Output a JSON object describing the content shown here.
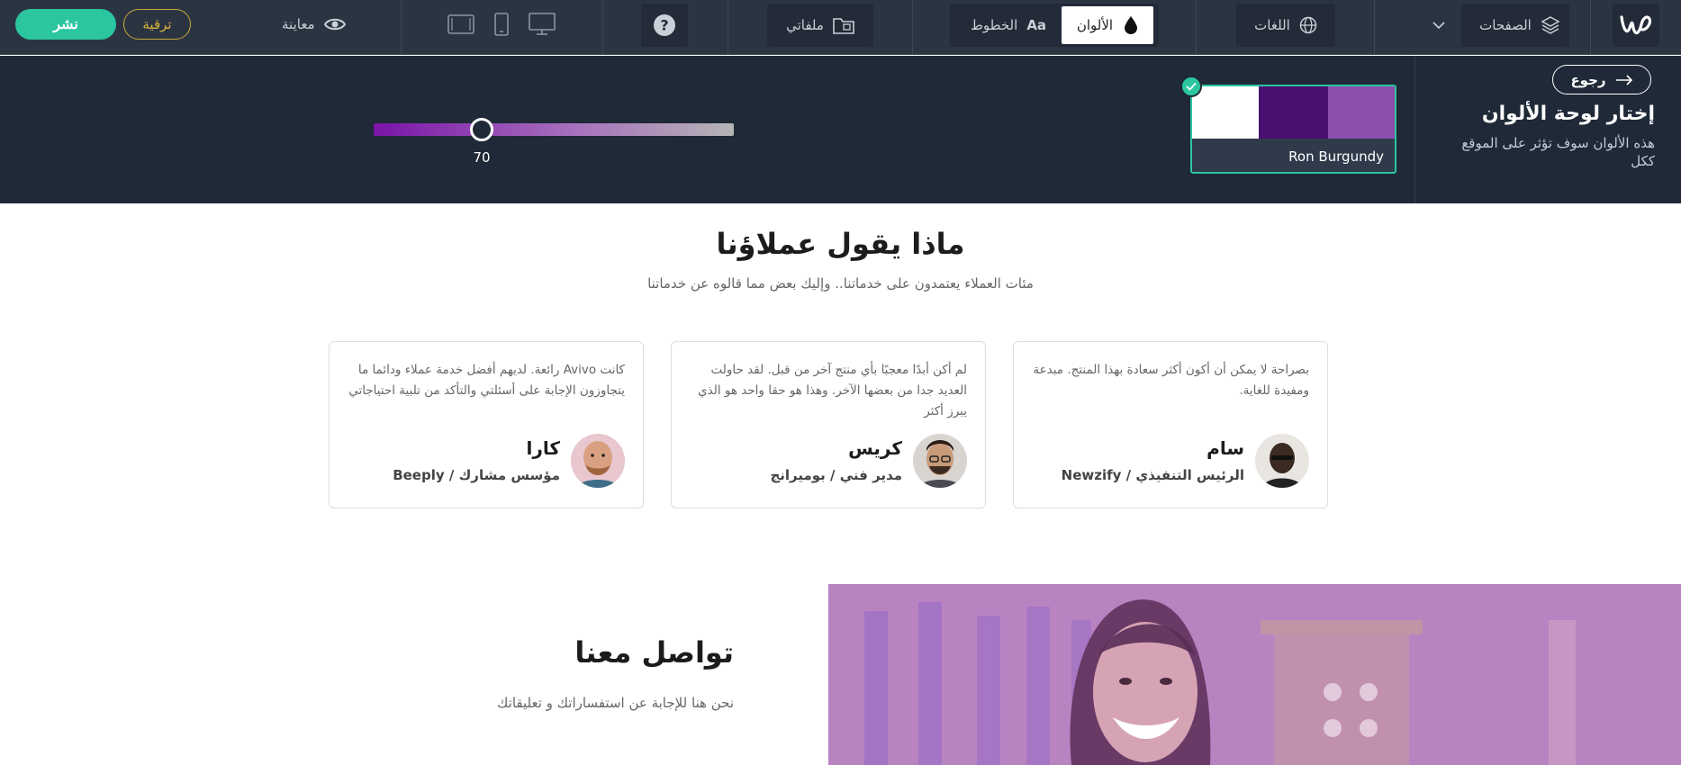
{
  "topbar": {
    "publish_label": "نشر",
    "upgrade_label": "ترقية",
    "preview_label": "معاينة",
    "files_label": "ملفاتي",
    "fonts_label": "الخطوط",
    "fonts_glyph": "Aa",
    "colors_label": "الألوان",
    "languages_label": "اللغات",
    "pages_label": "الصفحات",
    "help_glyph": "?"
  },
  "palette_panel": {
    "back_label": "رجوع",
    "title": "إختار لوحة الألوان",
    "description": "هذه الألوان سوف تؤثر على الموقع ككل",
    "selected_palette": {
      "name": "Ron Burgundy",
      "colors": [
        "#ffffff",
        "#4a1070",
        "#8c4fad"
      ]
    },
    "slider_value": 70
  },
  "testimonials": {
    "title": "ماذا يقول عملاؤنا",
    "subtitle": "مئات العملاء يعتمدون على خدماتنا.. وإليك بعض مما قالوه عن خدماتنا",
    "items": [
      {
        "quote": "بصراحة لا يمكن أن أكون أكثر سعادة بهذا المنتج. مبدعة ومفيدة للغاية.",
        "name": "سام",
        "role": "الرئيس التنفيذي / Newzify"
      },
      {
        "quote": "لم أكن أبدًا معجبًا بأي منتج آخر من قبل. لقد حاولت العديد جدا من بعضها الآخر. وهذا هو حقا واحد هو الذي يبرز أكثر",
        "name": "كريس",
        "role": "مدير فني / بوميرانج"
      },
      {
        "quote": "كانت Avivo رائعة. لديهم أفضل خدمة عملاء ودائما ما يتجاوزون الإجابة على أسئلتي والتأكد من تلبية احتياجاتي",
        "name": "كارا",
        "role": "مؤسس مشارك / Beeply"
      }
    ]
  },
  "contact": {
    "title": "تواصل معنا",
    "subtitle": "نحن هنا للإجابة عن استفساراتك و تعليقاتك"
  },
  "colors": {
    "accent": "#2bc6a0",
    "upgrade": "#d9b43e",
    "topbar_bg": "#2b3542",
    "panel_bg": "#1f2937"
  }
}
